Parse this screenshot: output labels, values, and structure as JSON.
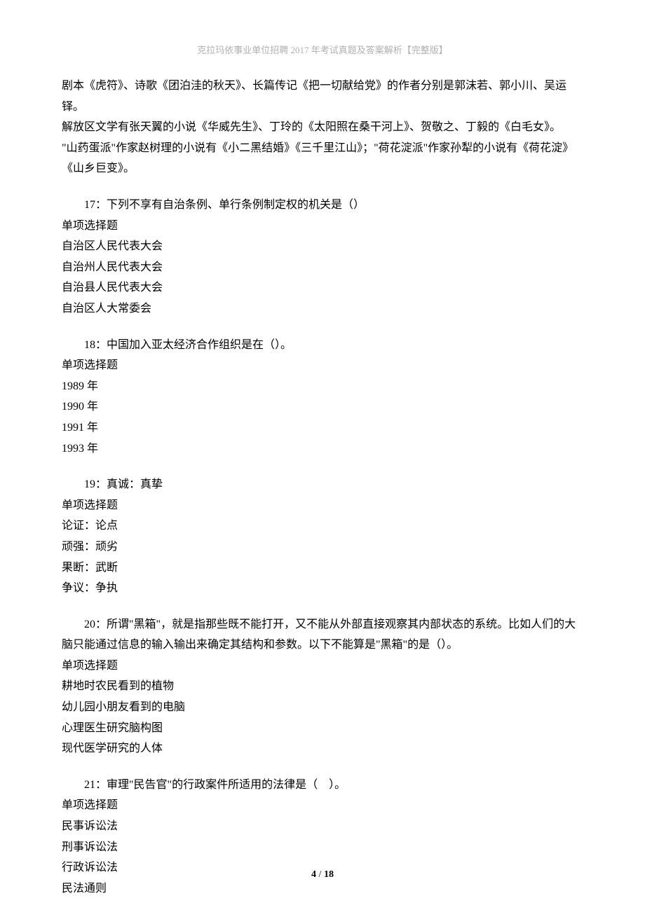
{
  "header": "克拉玛依事业单位招聘 2017 年考试真题及答案解析【完整版】",
  "intro": {
    "p1": "剧本《虎符》、诗歌《团泊洼的秋天》、长篇传记《把一切献给党》的作者分别是郭沫若、郭小川、吴运铎。",
    "p2": "解放区文学有张天翼的小说《华威先生》、丁玲的《太阳照在桑干河上》、贺敬之、丁毅的《白毛女》。",
    "p3": "\"山药蛋派\"作家赵树理的小说有《小二黑结婚》《三千里江山》；\"荷花淀派\"作家孙犁的小说有《荷花淀》《山乡巨变》。"
  },
  "q17": {
    "title": "17：下列不享有自治条例、单行条例制定权的机关是（）",
    "type": "单项选择题",
    "opts": [
      "自治区人民代表大会",
      "自治州人民代表大会",
      "自治县人民代表大会",
      "自治区人大常委会"
    ]
  },
  "q18": {
    "title": "18：中国加入亚太经济合作组织是在（）。",
    "type": "单项选择题",
    "opts": [
      "1989 年",
      "1990 年",
      "1991 年",
      "1993 年"
    ]
  },
  "q19": {
    "title": "19：真诚：真挚",
    "type": "单项选择题",
    "opts": [
      "论证：论点",
      "顽强：顽劣",
      "果断：武断",
      "争议：争执"
    ]
  },
  "q20": {
    "title": "20：所谓\"黑箱\"，就是指那些既不能打开，又不能从外部直接观察其内部状态的系统。比如人们的大脑只能通过信息的输入输出来确定其结构和参数。以下不能算是\"黑箱\"的是（）。",
    "type": "单项选择题",
    "opts": [
      "耕地时农民看到的植物",
      "幼儿园小朋友看到的电脑",
      "心理医生研究脑构图",
      "现代医学研究的人体"
    ]
  },
  "q21": {
    "title": "21：审理\"民告官\"的行政案件所适用的法律是（　）。",
    "type": "单项选择题",
    "opts": [
      "民事诉讼法",
      "刑事诉讼法",
      "行政诉讼法",
      "民法通则"
    ]
  },
  "footer": {
    "page": "4",
    "total": "18",
    "sep": " / "
  }
}
